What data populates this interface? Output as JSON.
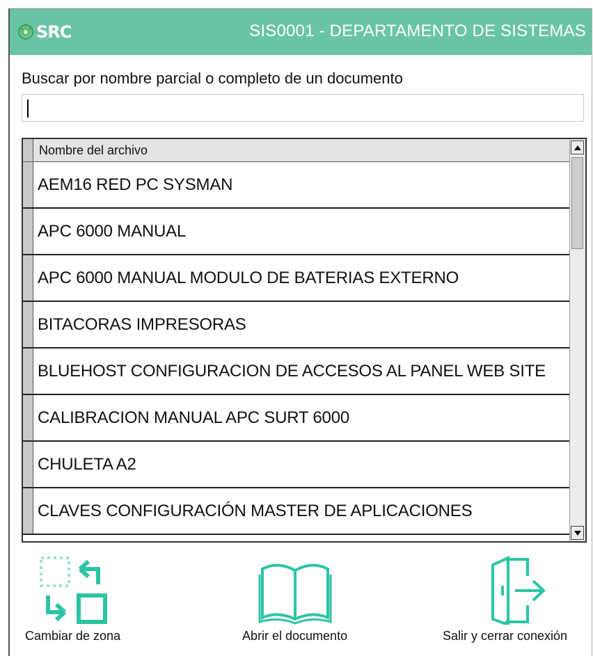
{
  "colors": {
    "accent": "#69c4a6",
    "icon": "#2dc4a4"
  },
  "header": {
    "logo_text": "SRC",
    "title": "SIS0001 - DEPARTAMENTO DE SISTEMAS"
  },
  "search": {
    "label": "Buscar por nombre parcial o completo de un documento",
    "value": "",
    "placeholder": ""
  },
  "table": {
    "columns": [
      "Nombre del archivo"
    ],
    "rows": [
      "AEM16 RED PC SYSMAN",
      "APC 6000 MANUAL",
      "APC 6000 MANUAL MODULO DE  BATERIAS EXTERNO",
      "BITACORAS IMPRESORAS",
      "BLUEHOST CONFIGURACION DE ACCESOS AL PANEL WEB SITE",
      "CALIBRACION MANUAL APC SURT 6000",
      "CHULETA A2",
      "CLAVES CONFIGURACIÓN MASTER DE APLICACIONES"
    ]
  },
  "actions": {
    "change_zone": {
      "label": "Cambiar de zona",
      "icon": "swap-zone-icon"
    },
    "open_document": {
      "label": "Abrir el documento",
      "icon": "open-book-icon"
    },
    "exit": {
      "label": "Salir y cerrar conexión",
      "icon": "exit-door-icon"
    }
  }
}
